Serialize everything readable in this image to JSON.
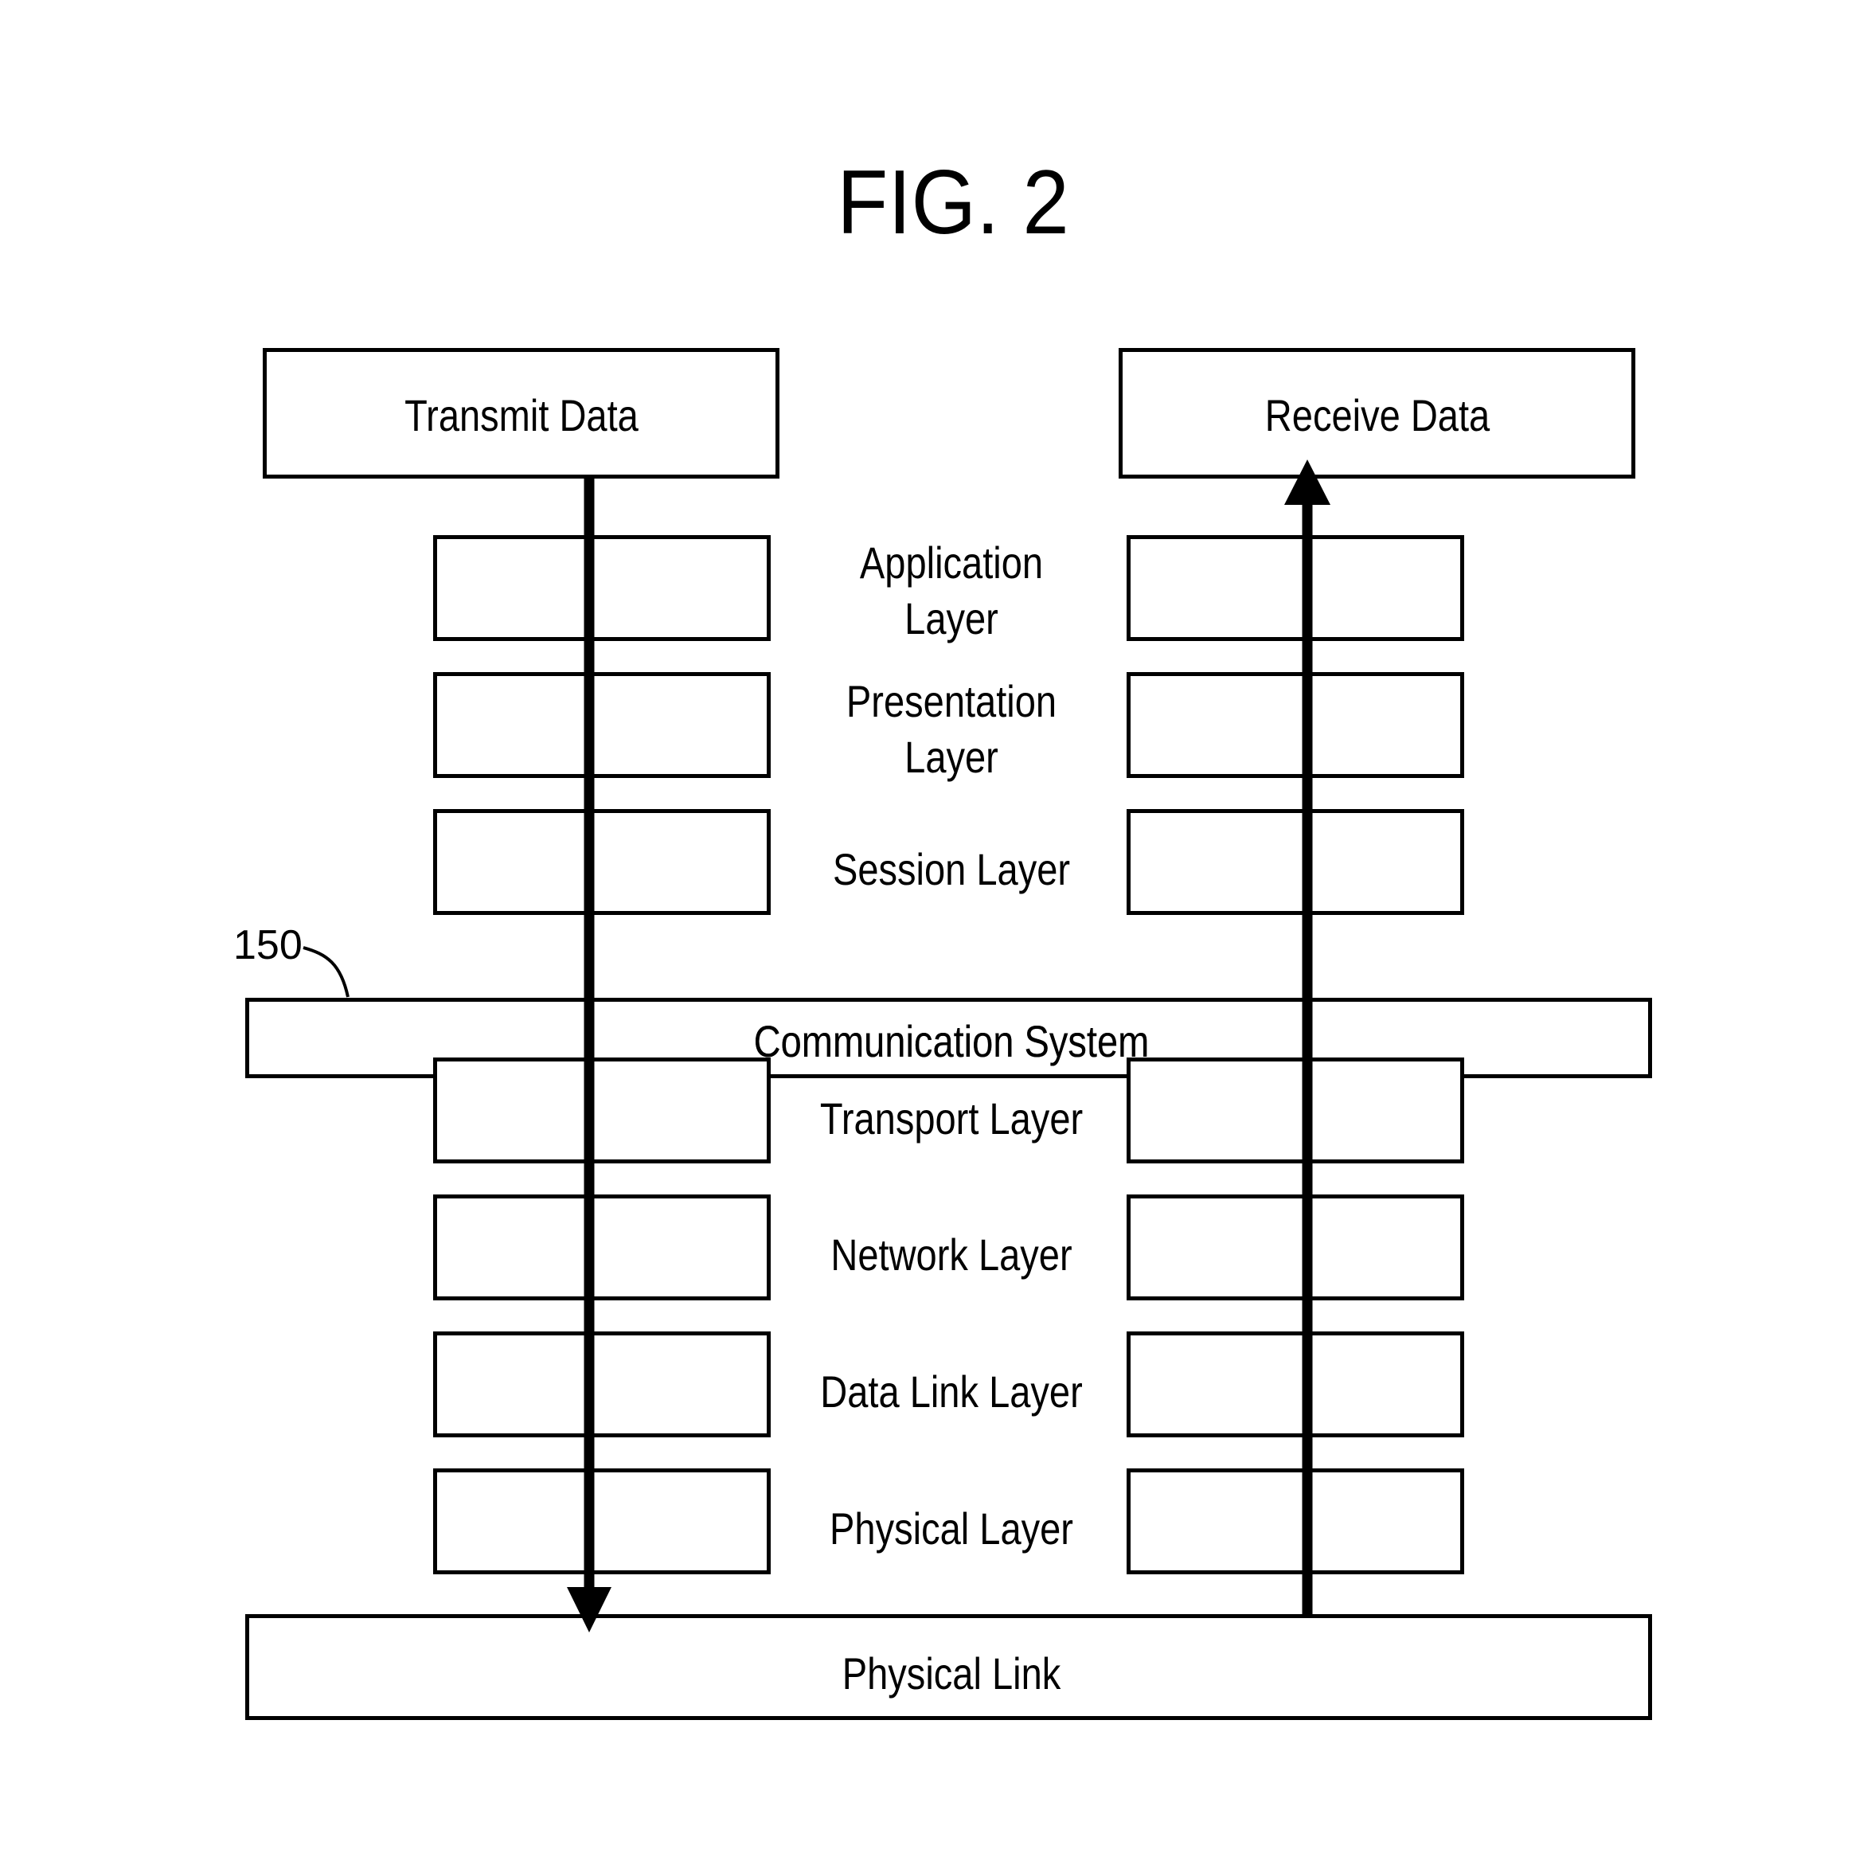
{
  "figure": {
    "title": "FIG. 2",
    "reference_numeral": "150"
  },
  "top_boxes": {
    "transmit": "Transmit Data",
    "receive": "Receive Data"
  },
  "communication_system": "Communication System",
  "layers": [
    {
      "line1": "Application",
      "line2": "Layer"
    },
    {
      "line1": "Presentation",
      "line2": "Layer"
    },
    {
      "line1": "Session Layer"
    },
    {
      "line1": "Transport Layer"
    },
    {
      "line1": "Network Layer"
    },
    {
      "line1": "Data Link Layer"
    },
    {
      "line1": "Physical Layer"
    }
  ],
  "physical_link": "Physical Link",
  "arrows": {
    "transmit_direction": "down",
    "receive_direction": "up"
  }
}
